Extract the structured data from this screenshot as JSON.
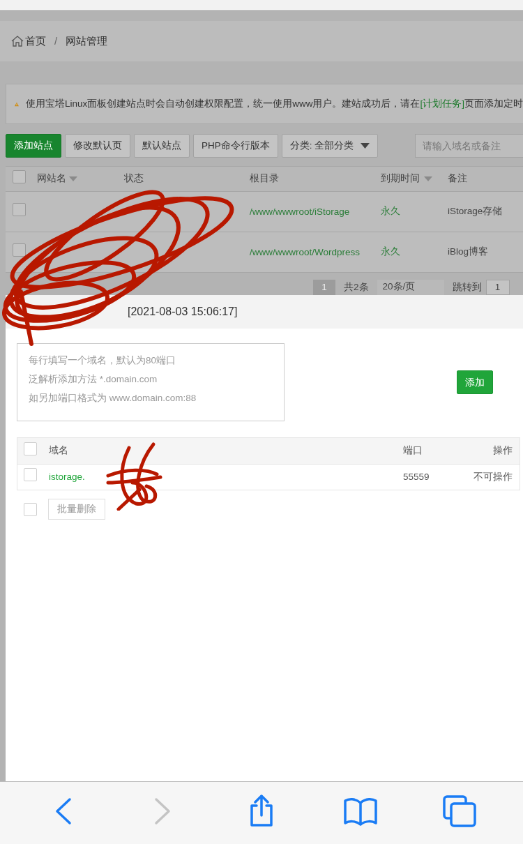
{
  "breadcrumb": {
    "items": [
      "首页",
      "网站管理"
    ],
    "separator": "/"
  },
  "notice": {
    "before": "使用宝塔Linux面板创建站点时会自动创建权限配置，统一使用www用户。建站成功后，请在",
    "link": "[计划任务]",
    "after": "页面添加定时"
  },
  "toolbar": {
    "buttons": [
      {
        "label": "添加站点",
        "kind": "primary"
      },
      {
        "label": "修改默认页",
        "kind": "default"
      },
      {
        "label": "默认站点",
        "kind": "default"
      },
      {
        "label": "PHP命令行版本",
        "kind": "default"
      }
    ],
    "category": "分类: 全部分类",
    "search_placeholder": "请输入域名或备注"
  },
  "sites_table": {
    "header_checked": false,
    "columns": [
      {
        "label": "网站名",
        "sortable": true
      },
      {
        "label": "状态",
        "sortable": false
      },
      {
        "label": "根目录",
        "sortable": false
      },
      {
        "label": "到期时间",
        "sortable": true
      },
      {
        "label": "备注",
        "sortable": false
      }
    ],
    "rows": [
      {
        "checked": false,
        "root": "/www/wwwroot/iStorage",
        "expiry": "永久",
        "note": "iStorage存储"
      },
      {
        "checked": false,
        "root": "/www/wwwroot/Wordpress",
        "expiry": "永久",
        "note": "iBlog博客"
      }
    ]
  },
  "pagination": {
    "pages": [
      {
        "label": "1",
        "selected": true
      }
    ],
    "total": "共2条",
    "page_size": "20条/页",
    "jump_label": "跳转到",
    "jump_value": "1"
  },
  "modal": {
    "title": "[2021-08-03 15:06:17]",
    "placeholder_lines": [
      "每行填写一个域名，默认为80端口",
      "泛解析添加方法 *.domain.com",
      "如另加端口格式为 www.domain.com:88"
    ],
    "add_button": "添加",
    "header_checked": false,
    "columns": [
      "域名",
      "端口",
      "操作"
    ],
    "rows": [
      {
        "checked": false,
        "domain": "istorage.",
        "port": "55559",
        "action": "不可操作"
      }
    ],
    "footer": {
      "checked": false,
      "batch_delete": "批量删除"
    }
  },
  "safari_toolbar": [
    {
      "kind": "back",
      "disabled": false
    },
    {
      "kind": "forward",
      "disabled": true
    },
    {
      "kind": "share",
      "disabled": false
    },
    {
      "kind": "bookmarks",
      "disabled": false
    },
    {
      "kind": "tabs",
      "disabled": false
    }
  ]
}
